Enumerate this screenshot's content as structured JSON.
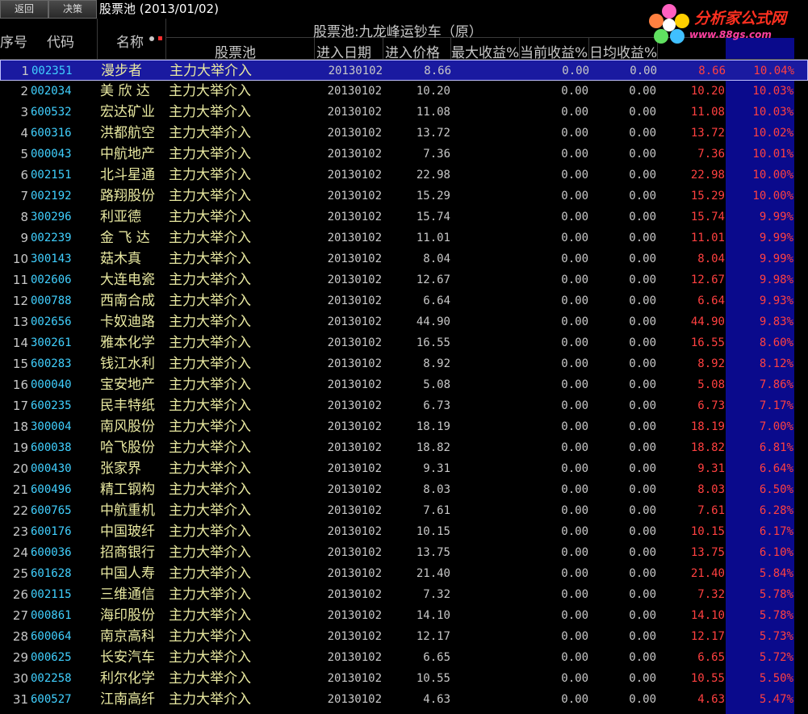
{
  "toolbar": {
    "back_label": "返回",
    "decision_label": "决策"
  },
  "title": "股票池 (2013/01/02)",
  "logo": {
    "name": "分析家公式网",
    "url": "www.88gs.com"
  },
  "pool_title": "股票池:九龙峰运钞车（原）",
  "headers": {
    "index": "序号",
    "code": "代码",
    "name": "名称",
    "pool": "股票池",
    "entry_date": "进入日期",
    "entry_price": "进入价格",
    "max_return": "最大收益%",
    "current_return": "当前收益%",
    "daily_avg_return": "日均收益%"
  },
  "colors": {
    "code": "#40d0ff",
    "name": "#e8e8a0",
    "gain": "#ff4040",
    "selected_row": "#1a1aa0",
    "pct_column": "#0a0a8c"
  },
  "rows": [
    {
      "idx": "1",
      "code": "002351",
      "name": "漫步者",
      "pool": "主力大举介入",
      "date": "20130102",
      "price": "8.66",
      "max": "0.00",
      "cur": "0.00",
      "avg": "8.66",
      "pct": "10.04%"
    },
    {
      "idx": "2",
      "code": "002034",
      "name": "美 欣 达",
      "pool": "主力大举介入",
      "date": "20130102",
      "price": "10.20",
      "max": "0.00",
      "cur": "0.00",
      "avg": "10.20",
      "pct": "10.03%"
    },
    {
      "idx": "3",
      "code": "600532",
      "name": "宏达矿业",
      "pool": "主力大举介入",
      "date": "20130102",
      "price": "11.08",
      "max": "0.00",
      "cur": "0.00",
      "avg": "11.08",
      "pct": "10.03%"
    },
    {
      "idx": "4",
      "code": "600316",
      "name": "洪都航空",
      "pool": "主力大举介入",
      "date": "20130102",
      "price": "13.72",
      "max": "0.00",
      "cur": "0.00",
      "avg": "13.72",
      "pct": "10.02%"
    },
    {
      "idx": "5",
      "code": "000043",
      "name": "中航地产",
      "pool": "主力大举介入",
      "date": "20130102",
      "price": "7.36",
      "max": "0.00",
      "cur": "0.00",
      "avg": "7.36",
      "pct": "10.01%"
    },
    {
      "idx": "6",
      "code": "002151",
      "name": "北斗星通",
      "pool": "主力大举介入",
      "date": "20130102",
      "price": "22.98",
      "max": "0.00",
      "cur": "0.00",
      "avg": "22.98",
      "pct": "10.00%"
    },
    {
      "idx": "7",
      "code": "002192",
      "name": "路翔股份",
      "pool": "主力大举介入",
      "date": "20130102",
      "price": "15.29",
      "max": "0.00",
      "cur": "0.00",
      "avg": "15.29",
      "pct": "10.00%"
    },
    {
      "idx": "8",
      "code": "300296",
      "name": "利亚德",
      "pool": "主力大举介入",
      "date": "20130102",
      "price": "15.74",
      "max": "0.00",
      "cur": "0.00",
      "avg": "15.74",
      "pct": "9.99%"
    },
    {
      "idx": "9",
      "code": "002239",
      "name": "金 飞 达",
      "pool": "主力大举介入",
      "date": "20130102",
      "price": "11.01",
      "max": "0.00",
      "cur": "0.00",
      "avg": "11.01",
      "pct": "9.99%"
    },
    {
      "idx": "10",
      "code": "300143",
      "name": "菇木真",
      "pool": "主力大举介入",
      "date": "20130102",
      "price": "8.04",
      "max": "0.00",
      "cur": "0.00",
      "avg": "8.04",
      "pct": "9.99%"
    },
    {
      "idx": "11",
      "code": "002606",
      "name": "大连电瓷",
      "pool": "主力大举介入",
      "date": "20130102",
      "price": "12.67",
      "max": "0.00",
      "cur": "0.00",
      "avg": "12.67",
      "pct": "9.98%"
    },
    {
      "idx": "12",
      "code": "000788",
      "name": "西南合成",
      "pool": "主力大举介入",
      "date": "20130102",
      "price": "6.64",
      "max": "0.00",
      "cur": "0.00",
      "avg": "6.64",
      "pct": "9.93%"
    },
    {
      "idx": "13",
      "code": "002656",
      "name": "卡奴迪路",
      "pool": "主力大举介入",
      "date": "20130102",
      "price": "44.90",
      "max": "0.00",
      "cur": "0.00",
      "avg": "44.90",
      "pct": "9.83%"
    },
    {
      "idx": "14",
      "code": "300261",
      "name": "雅本化学",
      "pool": "主力大举介入",
      "date": "20130102",
      "price": "16.55",
      "max": "0.00",
      "cur": "0.00",
      "avg": "16.55",
      "pct": "8.60%"
    },
    {
      "idx": "15",
      "code": "600283",
      "name": "钱江水利",
      "pool": "主力大举介入",
      "date": "20130102",
      "price": "8.92",
      "max": "0.00",
      "cur": "0.00",
      "avg": "8.92",
      "pct": "8.12%"
    },
    {
      "idx": "16",
      "code": "000040",
      "name": "宝安地产",
      "pool": "主力大举介入",
      "date": "20130102",
      "price": "5.08",
      "max": "0.00",
      "cur": "0.00",
      "avg": "5.08",
      "pct": "7.86%"
    },
    {
      "idx": "17",
      "code": "600235",
      "name": "民丰特纸",
      "pool": "主力大举介入",
      "date": "20130102",
      "price": "6.73",
      "max": "0.00",
      "cur": "0.00",
      "avg": "6.73",
      "pct": "7.17%"
    },
    {
      "idx": "18",
      "code": "300004",
      "name": "南风股份",
      "pool": "主力大举介入",
      "date": "20130102",
      "price": "18.19",
      "max": "0.00",
      "cur": "0.00",
      "avg": "18.19",
      "pct": "7.00%"
    },
    {
      "idx": "19",
      "code": "600038",
      "name": "哈飞股份",
      "pool": "主力大举介入",
      "date": "20130102",
      "price": "18.82",
      "max": "0.00",
      "cur": "0.00",
      "avg": "18.82",
      "pct": "6.81%"
    },
    {
      "idx": "20",
      "code": "000430",
      "name": "张家界",
      "pool": "主力大举介入",
      "date": "20130102",
      "price": "9.31",
      "max": "0.00",
      "cur": "0.00",
      "avg": "9.31",
      "pct": "6.64%"
    },
    {
      "idx": "21",
      "code": "600496",
      "name": "精工钢构",
      "pool": "主力大举介入",
      "date": "20130102",
      "price": "8.03",
      "max": "0.00",
      "cur": "0.00",
      "avg": "8.03",
      "pct": "6.50%"
    },
    {
      "idx": "22",
      "code": "600765",
      "name": "中航重机",
      "pool": "主力大举介入",
      "date": "20130102",
      "price": "7.61",
      "max": "0.00",
      "cur": "0.00",
      "avg": "7.61",
      "pct": "6.28%"
    },
    {
      "idx": "23",
      "code": "600176",
      "name": "中国玻纤",
      "pool": "主力大举介入",
      "date": "20130102",
      "price": "10.15",
      "max": "0.00",
      "cur": "0.00",
      "avg": "10.15",
      "pct": "6.17%"
    },
    {
      "idx": "24",
      "code": "600036",
      "name": "招商银行",
      "pool": "主力大举介入",
      "date": "20130102",
      "price": "13.75",
      "max": "0.00",
      "cur": "0.00",
      "avg": "13.75",
      "pct": "6.10%"
    },
    {
      "idx": "25",
      "code": "601628",
      "name": "中国人寿",
      "pool": "主力大举介入",
      "date": "20130102",
      "price": "21.40",
      "max": "0.00",
      "cur": "0.00",
      "avg": "21.40",
      "pct": "5.84%"
    },
    {
      "idx": "26",
      "code": "002115",
      "name": "三维通信",
      "pool": "主力大举介入",
      "date": "20130102",
      "price": "7.32",
      "max": "0.00",
      "cur": "0.00",
      "avg": "7.32",
      "pct": "5.78%"
    },
    {
      "idx": "27",
      "code": "000861",
      "name": "海印股份",
      "pool": "主力大举介入",
      "date": "20130102",
      "price": "14.10",
      "max": "0.00",
      "cur": "0.00",
      "avg": "14.10",
      "pct": "5.78%"
    },
    {
      "idx": "28",
      "code": "600064",
      "name": "南京高科",
      "pool": "主力大举介入",
      "date": "20130102",
      "price": "12.17",
      "max": "0.00",
      "cur": "0.00",
      "avg": "12.17",
      "pct": "5.73%"
    },
    {
      "idx": "29",
      "code": "000625",
      "name": "长安汽车",
      "pool": "主力大举介入",
      "date": "20130102",
      "price": "6.65",
      "max": "0.00",
      "cur": "0.00",
      "avg": "6.65",
      "pct": "5.72%"
    },
    {
      "idx": "30",
      "code": "002258",
      "name": "利尔化学",
      "pool": "主力大举介入",
      "date": "20130102",
      "price": "10.55",
      "max": "0.00",
      "cur": "0.00",
      "avg": "10.55",
      "pct": "5.50%"
    },
    {
      "idx": "31",
      "code": "600527",
      "name": "江南高纤",
      "pool": "主力大举介入",
      "date": "20130102",
      "price": "4.63",
      "max": "0.00",
      "cur": "0.00",
      "avg": "4.63",
      "pct": "5.47%"
    }
  ]
}
